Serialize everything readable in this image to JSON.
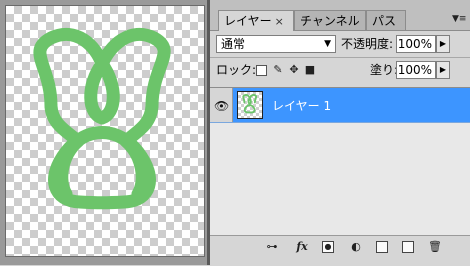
{
  "tabs": [
    {
      "label": "レイヤー",
      "close": "×",
      "active": true
    },
    {
      "label": "チャンネル",
      "active": false
    },
    {
      "label": "パス",
      "active": false
    }
  ],
  "panel_menu_icon": "panel-menu-icon",
  "blend_mode": {
    "value": "通常",
    "arrow": "▼"
  },
  "opacity": {
    "label": "不透明度:",
    "value": "100%",
    "spin": "▶"
  },
  "lock": {
    "label": "ロック:",
    "icons": [
      "lock-transparent-icon",
      "lock-image-icon",
      "lock-position-icon",
      "lock-all-icon"
    ]
  },
  "fill": {
    "label": "塗り:",
    "value": "100%",
    "spin": "▶"
  },
  "layers": [
    {
      "name": "レイヤー 1",
      "visible": true,
      "selected": true
    }
  ],
  "footer_icons": [
    "link-icon",
    "fx-icon",
    "mask-icon",
    "adjustment-icon",
    "folder-icon",
    "new-layer-icon",
    "trash-icon"
  ],
  "footer_fx": "fx",
  "colors": {
    "selection": "#3d95ff",
    "shape": "#6cc46a"
  }
}
